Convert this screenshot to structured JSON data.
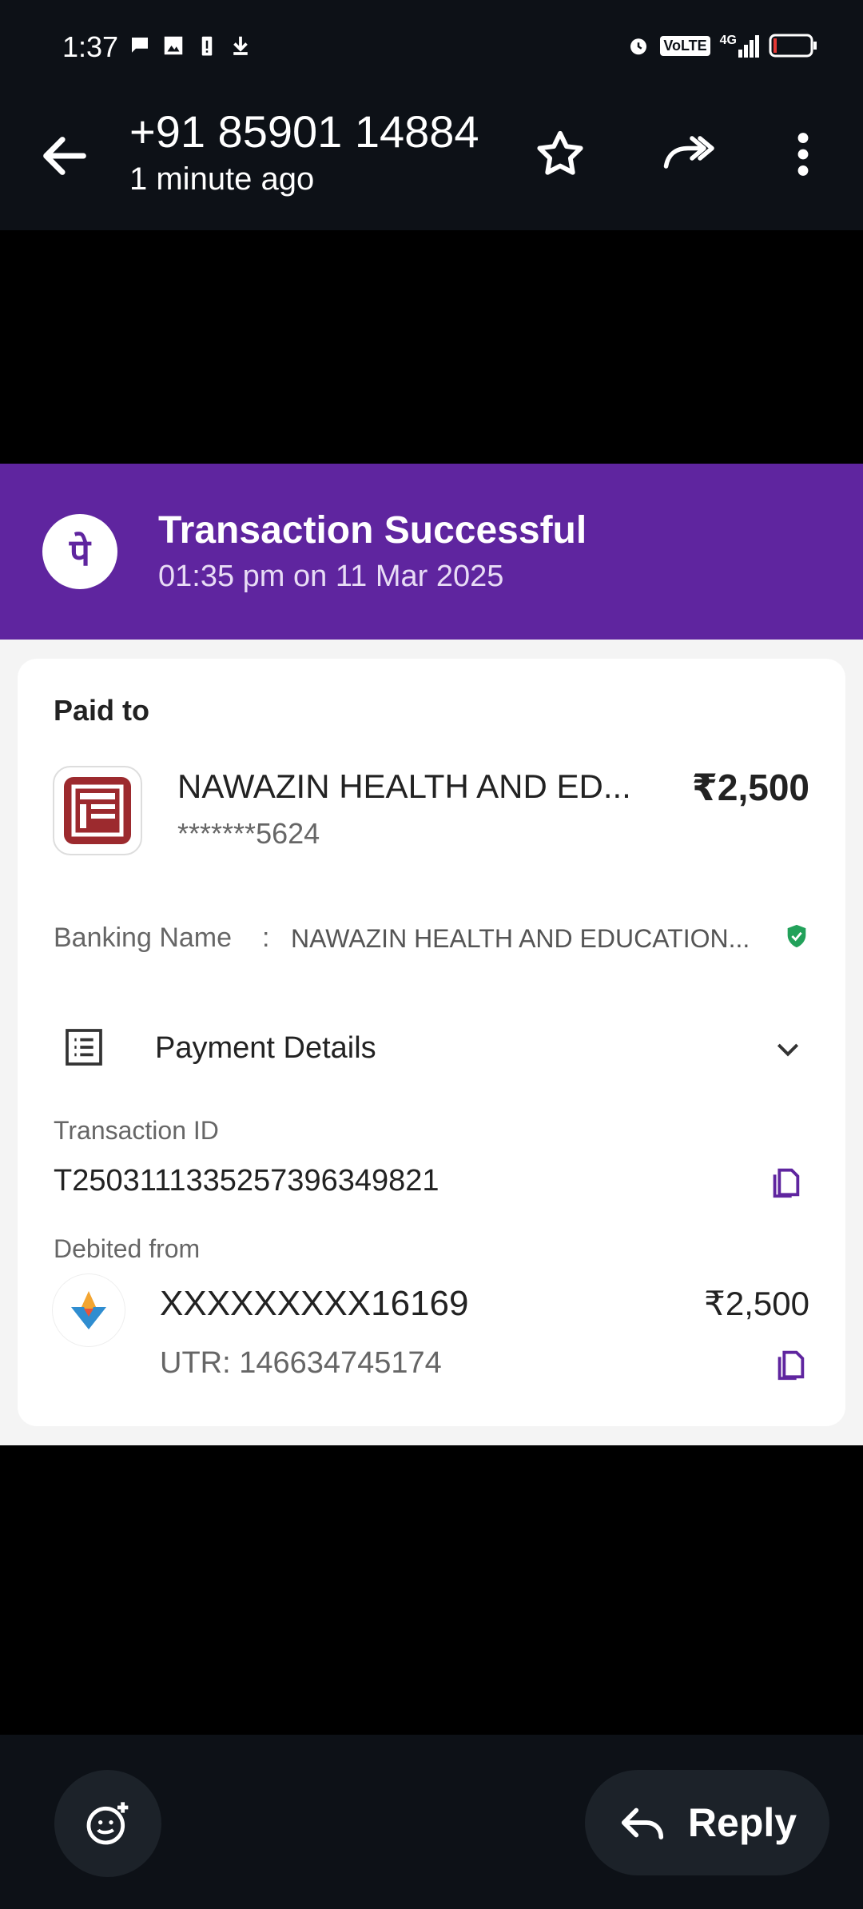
{
  "status_bar": {
    "time": "1:37",
    "left_icons": [
      "chat-bubble-icon",
      "image-alert-icon",
      "battery-alert-icon",
      "download-icon"
    ],
    "right_icons": [
      "alarm-icon",
      "volte-icon",
      "signal-4g-icon",
      "battery-icon"
    ],
    "volte_text": "VoLTE",
    "network_text": "4G"
  },
  "header": {
    "title": "+91 85901 14884",
    "subtitle": "1 minute ago",
    "actions": [
      "star-icon",
      "forward-icon",
      "more-vert-icon"
    ]
  },
  "receipt": {
    "banner": {
      "logo_glyph": "पे",
      "title": "Transaction Successful",
      "subtitle": "01:35 pm on 11 Mar 2025",
      "color": "#5f259f"
    },
    "paid_to_label": "Paid to",
    "merchant_name": "NAWAZIN HEALTH AND ED...",
    "merchant_account": "*******5624",
    "amount": "₹2,500",
    "banking_name_label": "Banking Name",
    "banking_name_colon": ":",
    "banking_name_value": "NAWAZIN HEALTH AND EDUCATION...",
    "payment_details_label": "Payment Details",
    "transaction_id_label": "Transaction ID",
    "transaction_id": "T2503111335257396349821",
    "debited_from_label": "Debited from",
    "debit_account": "XXXXXXXXX16169",
    "utr": "UTR: 146634745174",
    "debit_amount": "₹2,500",
    "verified_color": "#22a15a"
  },
  "bottom_bar": {
    "reply_label": "Reply"
  }
}
